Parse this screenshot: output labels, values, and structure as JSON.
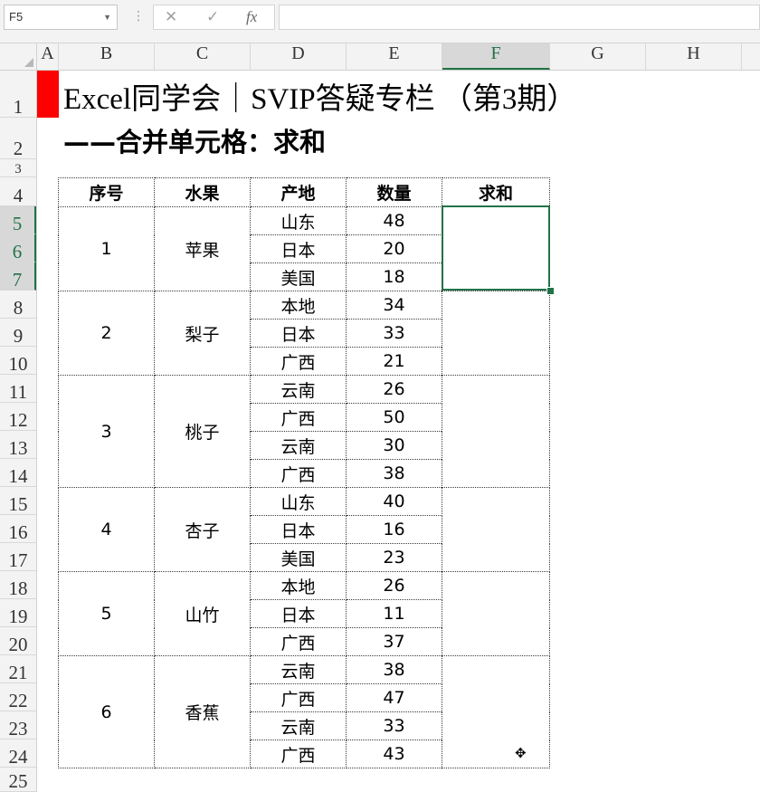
{
  "formula_bar": {
    "name_box": "F5",
    "cancel_icon": "✕",
    "enter_icon": "✓",
    "function_icon": "fx",
    "formula": ""
  },
  "columns": [
    "A",
    "B",
    "C",
    "D",
    "E",
    "F",
    "G",
    "H"
  ],
  "active_column": "F",
  "rows": [
    "1",
    "2",
    "3",
    "4",
    "5",
    "6",
    "7",
    "8",
    "9",
    "10",
    "11",
    "12",
    "13",
    "14",
    "15",
    "16",
    "17",
    "18",
    "19",
    "20",
    "21",
    "22",
    "23",
    "24",
    "25"
  ],
  "active_rows": [
    "5",
    "6",
    "7"
  ],
  "sheet": {
    "title": "Excel同学会｜SVIP答疑专栏 （第3期）",
    "subtitle": "——合并单元格：求和"
  },
  "table": {
    "headers": [
      "序号",
      "水果",
      "产地",
      "数量",
      "求和"
    ],
    "groups": [
      {
        "no": "1",
        "fruit": "苹果",
        "items": [
          [
            "山东",
            "48"
          ],
          [
            "日本",
            "20"
          ],
          [
            "美国",
            "18"
          ]
        ]
      },
      {
        "no": "2",
        "fruit": "梨子",
        "items": [
          [
            "本地",
            "34"
          ],
          [
            "日本",
            "33"
          ],
          [
            "广西",
            "21"
          ]
        ]
      },
      {
        "no": "3",
        "fruit": "桃子",
        "items": [
          [
            "云南",
            "26"
          ],
          [
            "广西",
            "50"
          ],
          [
            "云南",
            "30"
          ],
          [
            "广西",
            "38"
          ]
        ]
      },
      {
        "no": "4",
        "fruit": "杏子",
        "items": [
          [
            "山东",
            "40"
          ],
          [
            "日本",
            "16"
          ],
          [
            "美国",
            "23"
          ]
        ]
      },
      {
        "no": "5",
        "fruit": "山竹",
        "items": [
          [
            "本地",
            "26"
          ],
          [
            "日本",
            "11"
          ],
          [
            "广西",
            "37"
          ]
        ]
      },
      {
        "no": "6",
        "fruit": "香蕉",
        "items": [
          [
            "云南",
            "38"
          ],
          [
            "广西",
            "47"
          ],
          [
            "云南",
            "33"
          ],
          [
            "广西",
            "43"
          ]
        ]
      }
    ]
  },
  "accent_color": "#217346",
  "marker_color": "#ff0000"
}
